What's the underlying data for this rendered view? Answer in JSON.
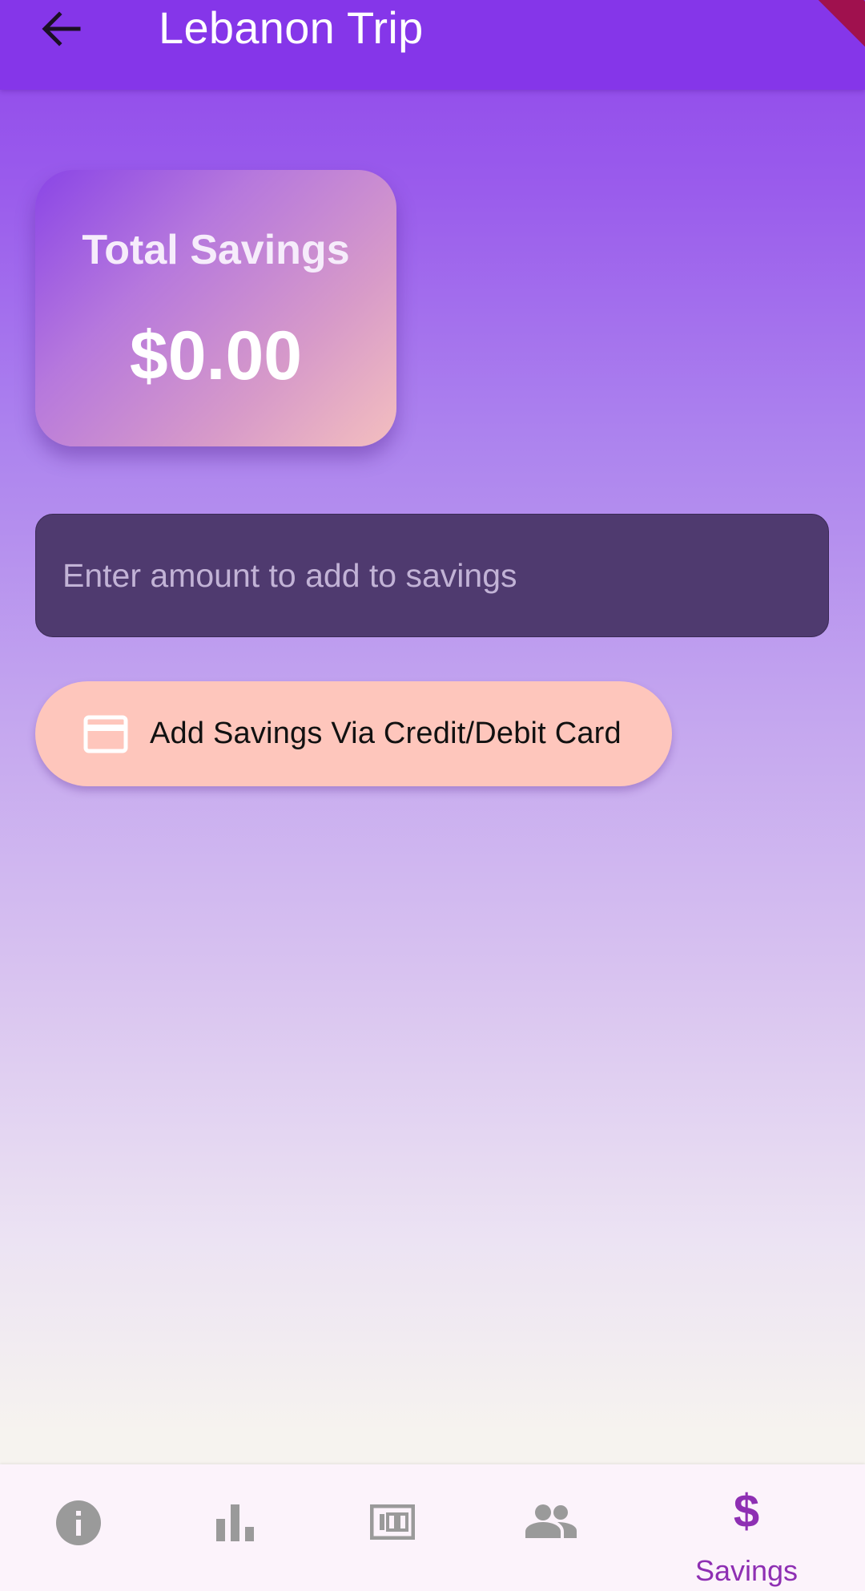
{
  "app_bar": {
    "title": "Lebanon Trip",
    "back_icon": "arrow-back-icon"
  },
  "savings_card": {
    "title": "Total Savings",
    "amount": "$0.00"
  },
  "amount_input": {
    "placeholder": "Enter amount to add to savings",
    "value": ""
  },
  "add_button": {
    "label": "Add Savings Via Credit/Debit Card",
    "icon": "credit-card-icon"
  },
  "bottom_nav": {
    "items": [
      {
        "icon": "info-icon",
        "label": "",
        "selected": false
      },
      {
        "icon": "bar-chart-icon",
        "label": "",
        "selected": false
      },
      {
        "icon": "money-icon",
        "label": "",
        "selected": false
      },
      {
        "icon": "people-icon",
        "label": "",
        "selected": false
      },
      {
        "icon": "dollar-icon",
        "label": "Savings",
        "selected": true
      }
    ]
  },
  "colors": {
    "app_bar": "#8536e9",
    "accent": "#8e2fb3",
    "button": "#fec6bc",
    "input_bg": "#4f3a6f",
    "nav_inactive": "#9a9a9a"
  }
}
